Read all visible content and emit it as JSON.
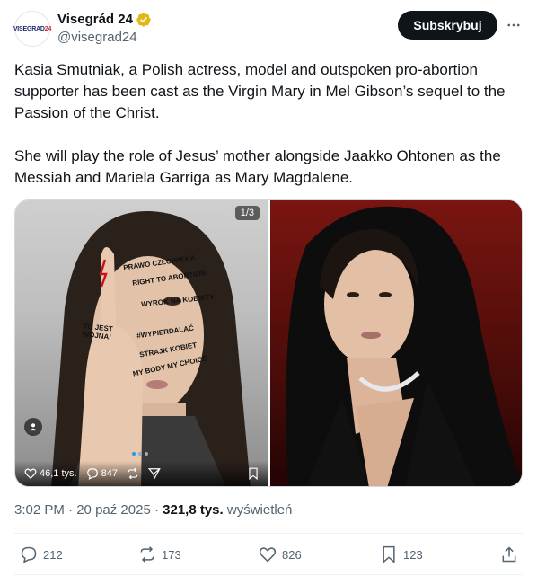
{
  "account": {
    "avatar_text_dark": "VISEGRAD",
    "avatar_text_red": "24",
    "display_name": "Visegrád 24",
    "handle": "@visegrad24"
  },
  "header": {
    "subscribe_label": "Subskrybuj"
  },
  "tweet": {
    "text": "Kasia Smutniak, a Polish actress, model and outspoken pro-abortion supporter has been cast as the Virgin Mary in Mel Gibson’s sequel to the Passion of the Christ.\n\nShe will play the role of Jesus’ mother alongside Jaakko Ohtonen as the Messiah and Mariela Garriga as Mary Magdalene."
  },
  "media": {
    "counter": "1/3",
    "left_image_text": [
      "PRAWO CZŁOWIEKA",
      "RIGHT TO ABORTION",
      "WYROK NA KOBIETY",
      "#WYPIERDALAĆ",
      "STRAJK KOBIET",
      "MY BODY MY CHOICE",
      "TO JEST WOJNA!"
    ],
    "embedded_likes": "46,1 tys.",
    "embedded_replies": "847"
  },
  "meta": {
    "time": "3:02 PM",
    "date": "20 paź 2025",
    "views_count": "321,8 tys.",
    "views_label": "wyświetleń"
  },
  "stats": {
    "replies": "212",
    "reposts": "173",
    "likes": "826",
    "bookmarks": "123"
  },
  "colors": {
    "verified_gold": "#e2b719",
    "button_dark": "#0f1419",
    "secondary_text": "#536471"
  }
}
